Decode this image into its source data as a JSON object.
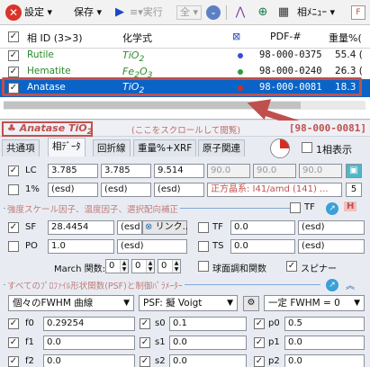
{
  "toolbar": {
    "settings": "設定",
    "save": "保存",
    "run": "実行",
    "all": "全",
    "phase_menu": "相ﾒﾆｭｰ"
  },
  "grid": {
    "columns": [
      "相 ID (3>3)",
      "化学式",
      "PDF-#",
      "重量%("
    ],
    "rows": [
      {
        "name": "Rutile",
        "formula": "TiO",
        "sub": "2",
        "pdf": "98-000-0375",
        "wt": "55.4 (",
        "color": "#3b4bd8",
        "checked": "✓"
      },
      {
        "name": "Hematite",
        "formula": "Fe",
        "sub": "2",
        "formula2": "O",
        "sub2": "3",
        "pdf": "98-000-0240",
        "wt": "26.3 (",
        "color": "#2e9b3a",
        "checked": "✓"
      },
      {
        "name": "Anatase",
        "formula": "TiO",
        "sub": "2",
        "pdf": "98-000-0081",
        "wt": "18.3 (",
        "color": "#d92a22",
        "checked": "✓"
      }
    ]
  },
  "pane": {
    "title": "Anatase TiO",
    "title_sub": "2",
    "hint": "(ここをスクロールして閲覧)",
    "pdf_ref": "[98-000-0081]",
    "tabs": [
      "共通項",
      "相ﾃﾞｰﾀ",
      "回折線",
      "重量%+XRF",
      "原子関連"
    ],
    "one_phase_label": "1相表示",
    "lc": {
      "label": "LC",
      "a": "3.785",
      "b": "3.785",
      "c": "9.514",
      "g1": "90.0",
      "g2": "90.0",
      "g3": "90.0",
      "btn": "5"
    },
    "pct": {
      "label": "1%",
      "e1": "(esd)",
      "e2": "(esd)",
      "e3": "(esd)",
      "sg": "正方晶系: I41/amd (141) ...",
      "num": "5"
    },
    "section1": "強度スケール因子、温度因子、選択配向補正",
    "tf_label": "TF",
    "h_label": "H",
    "sf": {
      "label": "SF",
      "value": "28.4454",
      "esd": "(esd",
      "link": "リンク.."
    },
    "tf": {
      "label": "TF",
      "value": "0.0",
      "esd": "(esd)"
    },
    "po": {
      "label": "PO",
      "value": "1.0",
      "esd": "(esd)"
    },
    "ts": {
      "label": "TS",
      "value": "0.0",
      "esd": "(esd)"
    },
    "march": {
      "label": "March 関数:",
      "v1": "0",
      "v2": "0",
      "v3": "0"
    },
    "sph_label": "球面調和関数",
    "spinner_label": "スピナー",
    "section2": "すべてのﾌﾟﾛﾌｧｲﾙ形状関数(PSF)と制御ﾊﾟﾗﾒｰﾀｰ",
    "fwhm_curve": "個々のFWHM 曲線",
    "psf": "PSF: 擬 Voigt",
    "fwhm_const": "一定 FWHM = 0",
    "params": [
      {
        "k": "f0",
        "v": "0.29254",
        "k2": "s0",
        "v2": "0.1",
        "k3": "p0",
        "v3": "0.5"
      },
      {
        "k": "f1",
        "v": "0.0",
        "k2": "s1",
        "v2": "0.0",
        "k3": "p1",
        "v3": "0.0"
      },
      {
        "k": "f2",
        "v": "0.0",
        "k2": "s2",
        "v2": "0.0",
        "k3": "p2",
        "v3": "0.0"
      }
    ]
  }
}
